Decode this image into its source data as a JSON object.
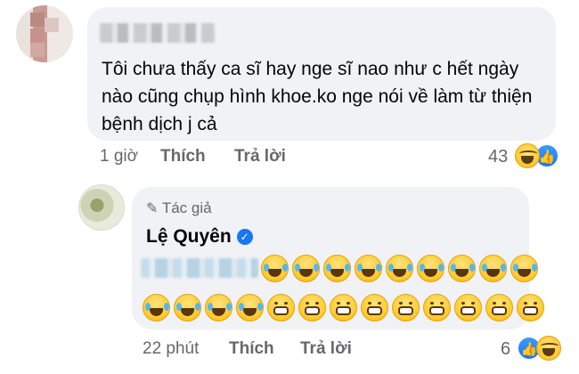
{
  "comment": {
    "text": "Tôi chưa thấy ca sĩ hay nge sĩ nao như c hết ngày nào cũng chụp hình khoe.ko nge nói về làm từ thiện bệnh dịch j cả",
    "time": "1 giờ",
    "like_label": "Thích",
    "reply_label": "Trả lời",
    "reaction_count": "43",
    "reactions": [
      "laugh-icon",
      "like-icon"
    ]
  },
  "reply": {
    "author_badge": "Tác giả",
    "author_name": "Lệ Quyên",
    "verified": true,
    "emoji_row1": [
      "cry-laugh",
      "cry-laugh",
      "cry-laugh",
      "cry-laugh",
      "cry-laugh",
      "cry-laugh",
      "cry-laugh",
      "cry-laugh",
      "cry-laugh"
    ],
    "emoji_row2": [
      "cry-laugh",
      "cry-laugh",
      "cry-laugh",
      "cry-laugh",
      "grin",
      "grin",
      "grin",
      "grin",
      "grin",
      "grin",
      "grin",
      "grin",
      "grin"
    ],
    "time": "22 phút",
    "like_label": "Thích",
    "reply_label": "Trả lời",
    "reaction_count": "6",
    "reactions": [
      "like-icon",
      "laugh-icon"
    ]
  },
  "colors": {
    "bubble": "#f0f2f5",
    "meta": "#65676b",
    "accent": "#1877f2"
  }
}
